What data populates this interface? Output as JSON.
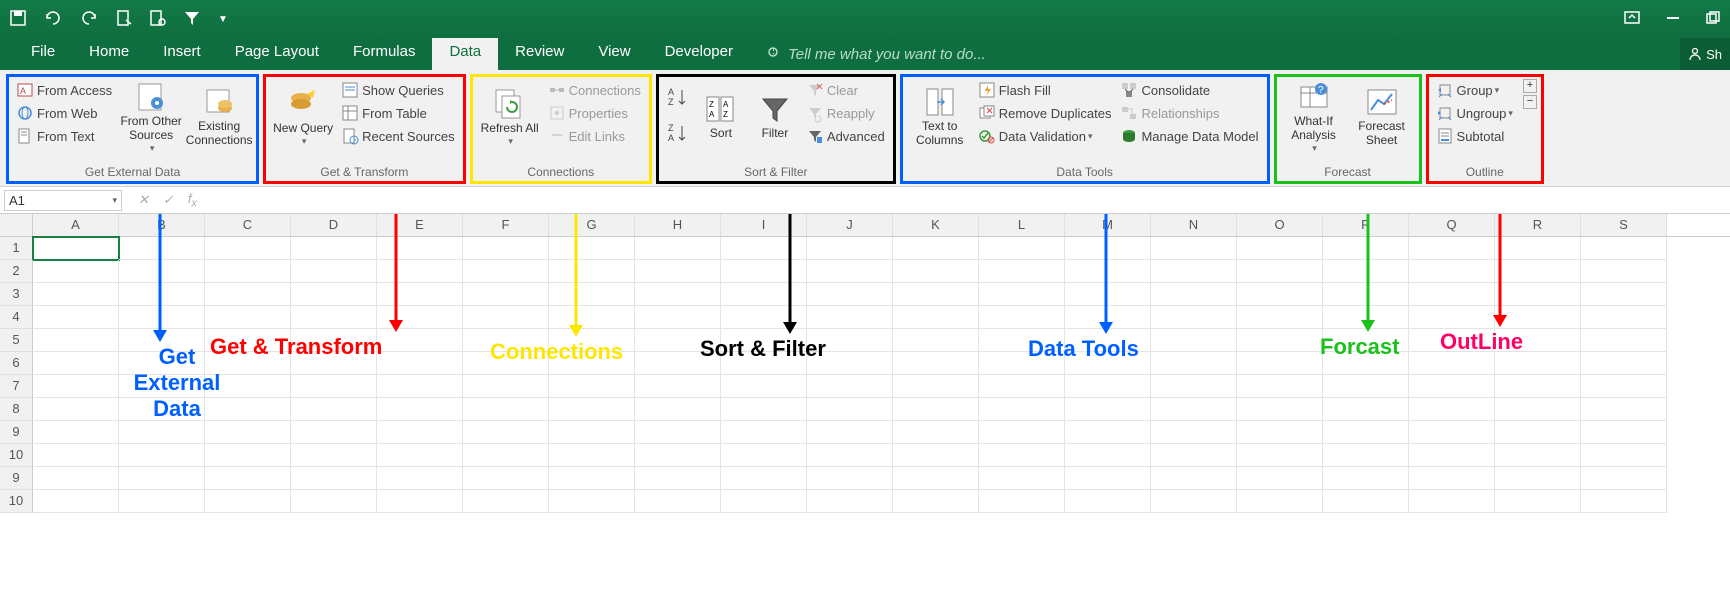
{
  "tabs": [
    "File",
    "Home",
    "Insert",
    "Page Layout",
    "Formulas",
    "Data",
    "Review",
    "View",
    "Developer"
  ],
  "active_tab": "Data",
  "tellme": "Tell me what you want to do...",
  "share": "Sh",
  "namebox": "A1",
  "ribbon": {
    "get_external": {
      "label": "Get External Data",
      "from_access": "From Access",
      "from_web": "From Web",
      "from_text": "From Text",
      "other_sources": "From Other Sources",
      "existing": "Existing Connections"
    },
    "get_transform": {
      "label": "Get & Transform",
      "new_query": "New Query",
      "show_queries": "Show Queries",
      "from_table": "From Table",
      "recent": "Recent Sources"
    },
    "connections": {
      "label": "Connections",
      "refresh": "Refresh All",
      "conn": "Connections",
      "props": "Properties",
      "edit": "Edit Links"
    },
    "sort_filter": {
      "label": "Sort & Filter",
      "sort": "Sort",
      "filter": "Filter",
      "clear": "Clear",
      "reapply": "Reapply",
      "advanced": "Advanced"
    },
    "data_tools": {
      "label": "Data Tools",
      "text_cols": "Text to Columns",
      "flash": "Flash Fill",
      "remove_dup": "Remove Duplicates",
      "validation": "Data Validation",
      "consolidate": "Consolidate",
      "relationships": "Relationships",
      "model": "Manage Data Model"
    },
    "forecast": {
      "label": "Forecast",
      "whatif": "What-If Analysis",
      "sheet": "Forecast Sheet"
    },
    "outline": {
      "label": "Outline",
      "group": "Group",
      "ungroup": "Ungroup",
      "subtotal": "Subtotal"
    }
  },
  "cols": [
    "A",
    "B",
    "C",
    "D",
    "E",
    "F",
    "G",
    "H",
    "I",
    "J",
    "K",
    "L",
    "M",
    "N",
    "O",
    "P",
    "Q",
    "R",
    "S"
  ],
  "rows": [
    "1",
    "2",
    "3",
    "4",
    "5",
    "6",
    "7",
    "8",
    "9",
    "10",
    "9",
    "10"
  ],
  "annotations": {
    "get_external": "Get External Data",
    "get_transform": "Get & Transform",
    "connections": "Connections",
    "sort_filter": "Sort & Filter",
    "data_tools": "Data Tools",
    "forecast": "Forcast",
    "outline": "OutLine"
  }
}
